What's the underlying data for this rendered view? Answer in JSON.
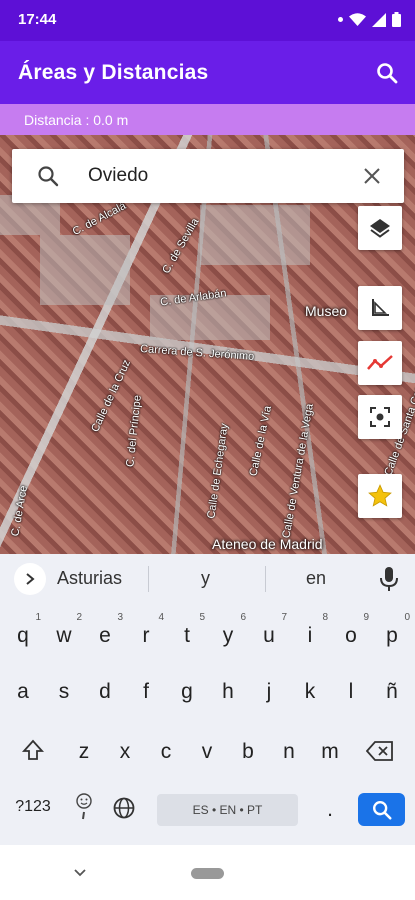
{
  "status": {
    "time": "17:44"
  },
  "appbar": {
    "title": "Áreas y Distancias",
    "search_icon": "search-icon"
  },
  "distance": {
    "text": "Distancia : 0.0 m"
  },
  "search": {
    "value": "Oviedo",
    "clear_icon": "close-icon"
  },
  "map": {
    "labels": [
      "C. de Alcalá",
      "C. de Sevilla",
      "C. de Arlabán",
      "Carrera de S. Jerónimo",
      "Museo",
      "Calle de la Cruz",
      "C. del Príncipe",
      "Calle de Echegaray",
      "Calle de la Vía",
      "Calle de Ventura de la Vega",
      "Ateneo de Madrid",
      "C. de Arce",
      "Calle de Santa Catalina"
    ]
  },
  "tools": [
    "layers-icon",
    "ruler-angle-icon",
    "polyline-icon",
    "focus-icon",
    "star-icon"
  ],
  "keyboard": {
    "suggestions": [
      "Asturias",
      "y",
      "en"
    ],
    "row1": [
      "q",
      "w",
      "e",
      "r",
      "t",
      "y",
      "u",
      "i",
      "o",
      "p"
    ],
    "row1_nums": [
      "1",
      "2",
      "3",
      "4",
      "5",
      "6",
      "7",
      "8",
      "9",
      "0"
    ],
    "row2": [
      "a",
      "s",
      "d",
      "f",
      "g",
      "h",
      "j",
      "k",
      "l",
      "ñ"
    ],
    "row3": [
      "z",
      "x",
      "c",
      "v",
      "b",
      "n",
      "m"
    ],
    "symbols_label": "?123",
    "space_label": "ES • EN • PT",
    "period": "."
  },
  "colors": {
    "statusbar": "#5d10d6",
    "appbar": "#6a1ee8",
    "distbar": "#c67cf0",
    "enter": "#1a73e8"
  }
}
